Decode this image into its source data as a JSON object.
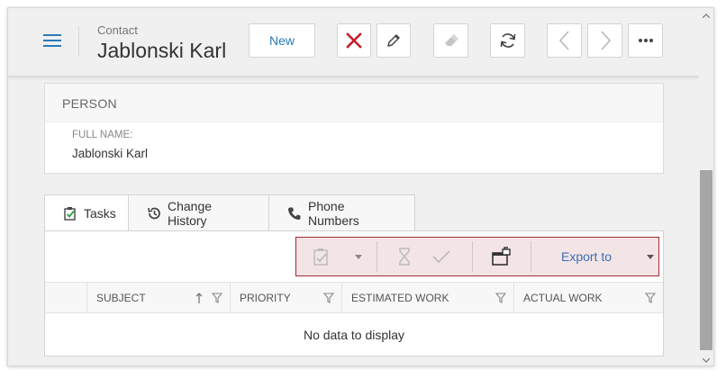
{
  "header": {
    "entity_type": "Contact",
    "entity_name": "Jablonski Karl",
    "new_label": "New",
    "icons": [
      "hamburger-icon",
      "delete-icon",
      "edit-icon",
      "eraser-icon",
      "refresh-icon",
      "chevron-left-icon",
      "chevron-right-icon",
      "more-icon"
    ],
    "colors": {
      "accent": "#2a7ab8",
      "delete": "#c0202e",
      "disabled": "#b8b8b8"
    }
  },
  "person": {
    "caption": "PERSON",
    "full_name_label": "FULL NAME:",
    "full_name_value": "Jablonski Karl"
  },
  "tabs": [
    {
      "label": "Tasks",
      "icon": "tasks-icon",
      "active": true
    },
    {
      "label": "Change History",
      "icon": "history-icon",
      "active": false
    },
    {
      "label": "Phone Numbers",
      "icon": "phone-icon",
      "active": false
    }
  ],
  "grid_toolbar": {
    "export_label": "Export to",
    "icons": [
      "task-action-icon",
      "hourglass-icon",
      "checkmark-icon",
      "unlock-window-icon"
    ],
    "colors": {
      "background": "#f3e4e6",
      "border": "#a42a35"
    }
  },
  "grid": {
    "columns": [
      {
        "label": "SUBJECT",
        "sorted": "ascending"
      },
      {
        "label": "PRIORITY"
      },
      {
        "label": "ESTIMATED WORK"
      },
      {
        "label": "ACTUAL WORK"
      }
    ],
    "empty_text": "No data to display"
  }
}
